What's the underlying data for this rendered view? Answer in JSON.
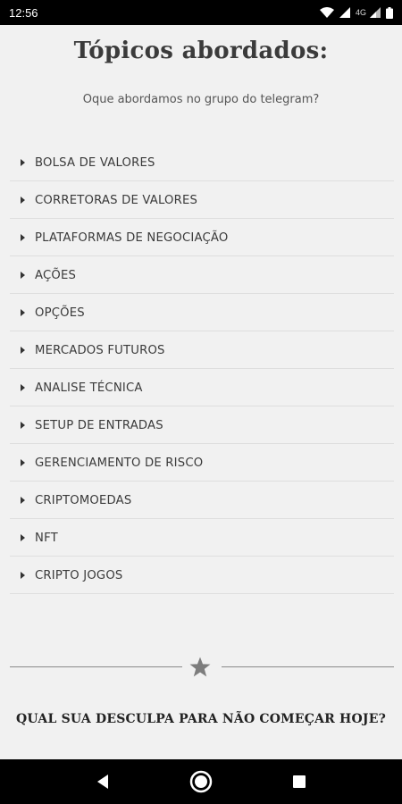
{
  "status_bar": {
    "time": "12:56",
    "network": "4G"
  },
  "page": {
    "title": "Tópicos abordados:",
    "subtitle": "Oque abordamos no grupo do telegram?"
  },
  "topics": [
    "BOLSA DE VALORES",
    "CORRETORAS DE VALORES",
    "PLATAFORMAS DE NEGOCIAÇÃO",
    "AÇÕES",
    "OPÇÕES",
    "MERCADOS FUTUROS",
    "ANALISE TÉCNICA",
    "SETUP DE ENTRADAS",
    "GERENCIAMENTO DE RISCO",
    "CRIPTOMOEDAS",
    "NFT",
    "CRIPTO JOGOS"
  ],
  "divider": {
    "icon": "star-icon"
  },
  "cta": {
    "text": "QUAL SUA DESCULPA PARA NÃO COMEÇAR HOJE?"
  },
  "nav": {
    "back": "back-icon",
    "home": "home-icon",
    "recents": "recents-icon"
  },
  "colors": {
    "background": "#f1f1f1",
    "bars": "#000000",
    "accent_gray": "#8a8a8a"
  }
}
